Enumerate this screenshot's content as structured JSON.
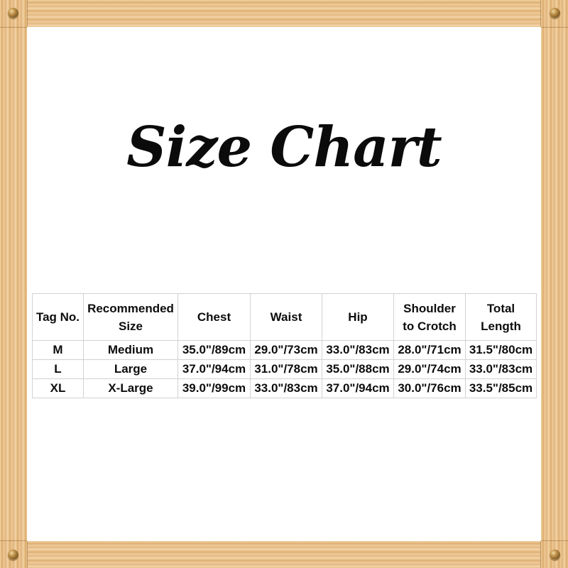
{
  "title": "Size Chart",
  "frame": {
    "style": "wooden-picture-frame",
    "wood_color": "#e8bf87",
    "screw_color": "#8a6228",
    "screws": [
      {
        "name": "screw-top-left"
      },
      {
        "name": "screw-top-right"
      },
      {
        "name": "screw-bottom-left"
      },
      {
        "name": "screw-bottom-right"
      }
    ]
  },
  "table": {
    "border_color": "#d2d2d2",
    "text_color": "#0d0d0d",
    "headers": [
      {
        "line1": "Tag No.",
        "line2": ""
      },
      {
        "line1": "Recommended",
        "line2": "Size"
      },
      {
        "line1": "Chest",
        "line2": ""
      },
      {
        "line1": "Waist",
        "line2": ""
      },
      {
        "line1": "Hip",
        "line2": ""
      },
      {
        "line1": "Shoulder",
        "line2": "to Crotch"
      },
      {
        "line1": "Total",
        "line2": "Length"
      }
    ],
    "rows": [
      {
        "tag": "M",
        "recommended": "Medium",
        "chest": "35.0\"/89cm",
        "waist": "29.0\"/73cm",
        "hip": "33.0\"/83cm",
        "shoulder_to_crotch": "28.0\"/71cm",
        "total_length": "31.5\"/80cm"
      },
      {
        "tag": "L",
        "recommended": "Large",
        "chest": "37.0\"/94cm",
        "waist": "31.0\"/78cm",
        "hip": "35.0\"/88cm",
        "shoulder_to_crotch": "29.0\"/74cm",
        "total_length": "33.0\"/83cm"
      },
      {
        "tag": "XL",
        "recommended": "X-Large",
        "chest": "39.0\"/99cm",
        "waist": "33.0\"/83cm",
        "hip": "37.0\"/94cm",
        "shoulder_to_crotch": "30.0\"/76cm",
        "total_length": "33.5\"/85cm"
      }
    ]
  }
}
